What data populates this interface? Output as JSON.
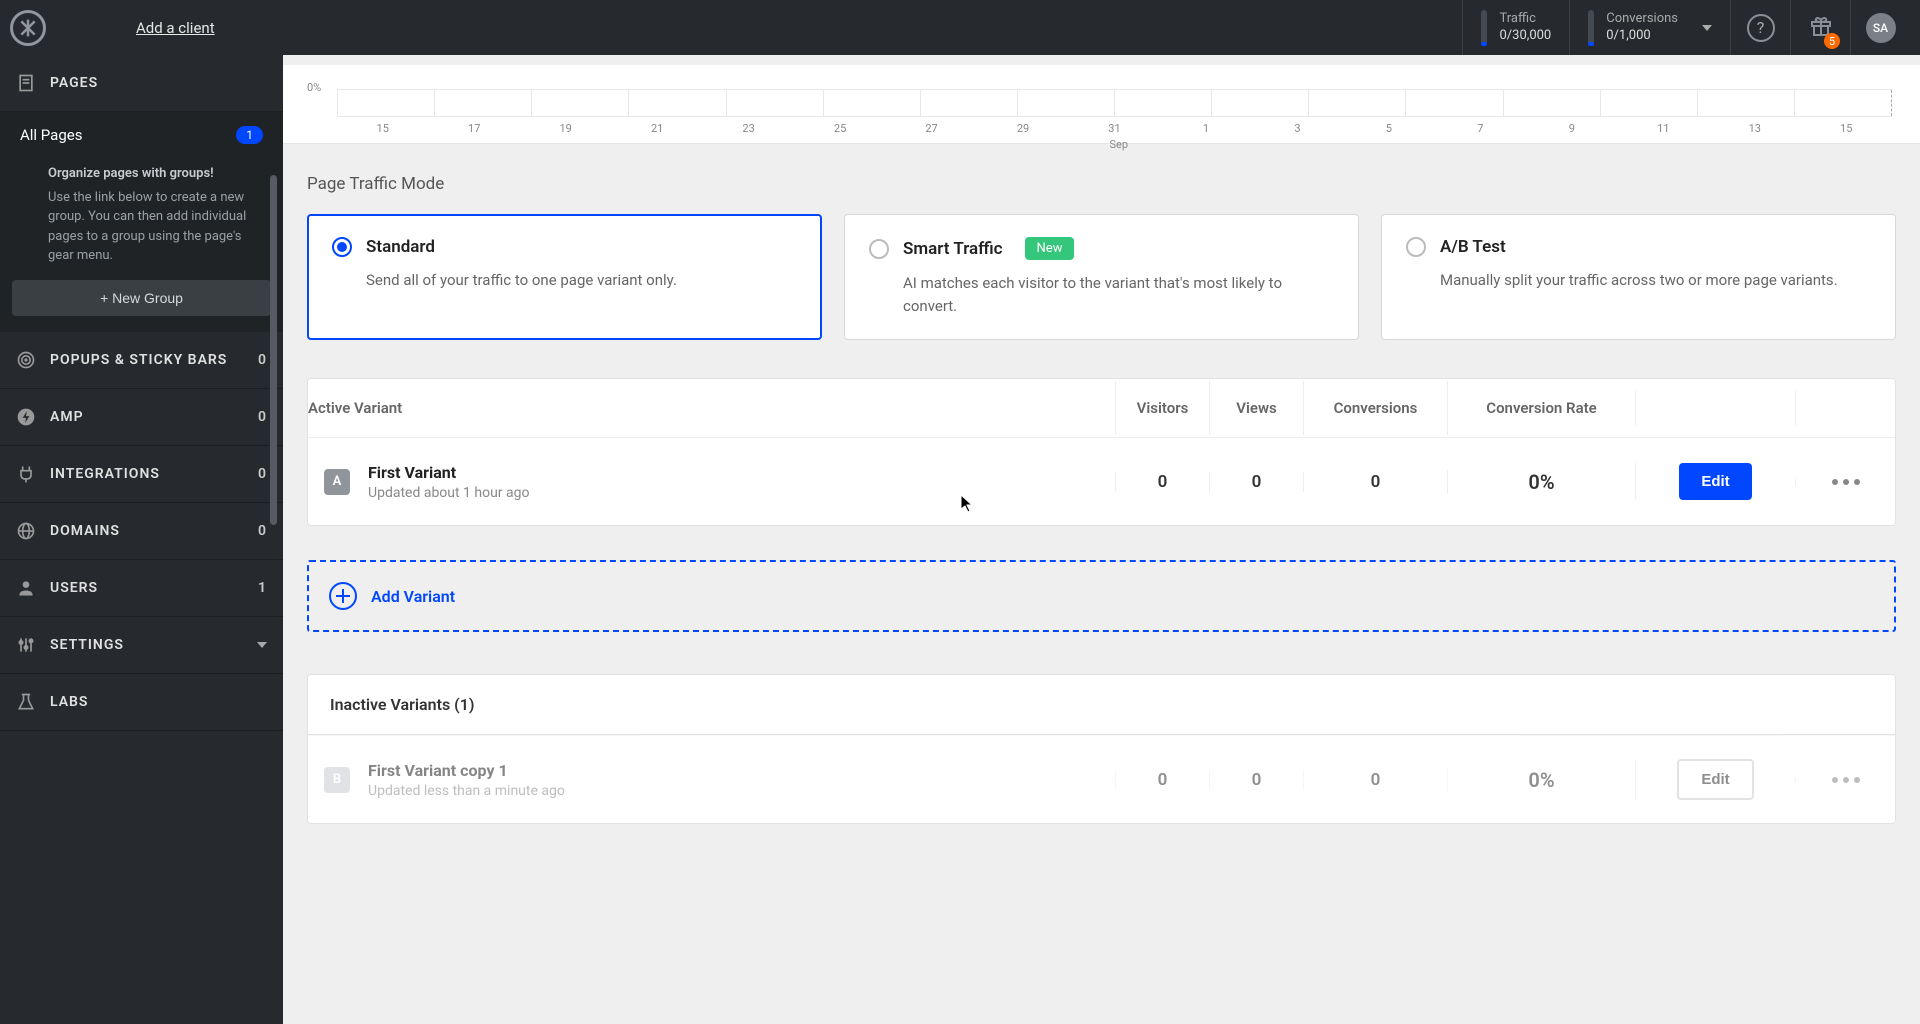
{
  "topbar": {
    "add_client": "Add a client",
    "traffic_label": "Traffic",
    "traffic_value": "0/30,000",
    "conversions_label": "Conversions",
    "conversions_value": "0/1,000",
    "gift_badge": "5",
    "avatar": "SA"
  },
  "sidebar": {
    "pages_label": "PAGES",
    "all_pages": "All Pages",
    "all_pages_count": "1",
    "groups_title": "Organize pages with groups!",
    "groups_body": "Use the link below to create a new group. You can then add individual pages to a group using the page's gear menu.",
    "new_group": "+ New Group",
    "items": [
      {
        "label": "POPUPS & STICKY BARS",
        "count": "0"
      },
      {
        "label": "AMP",
        "count": "0"
      },
      {
        "label": "INTEGRATIONS",
        "count": "0"
      },
      {
        "label": "DOMAINS",
        "count": "0"
      },
      {
        "label": "USERS",
        "count": "1"
      },
      {
        "label": "SETTINGS",
        "count": ""
      },
      {
        "label": "LABS",
        "count": ""
      }
    ]
  },
  "chart_data": {
    "type": "line",
    "ylabel": "0%",
    "month_label": "Sep",
    "categories": [
      "15",
      "17",
      "19",
      "21",
      "23",
      "25",
      "27",
      "29",
      "31",
      "1",
      "3",
      "5",
      "7",
      "9",
      "11",
      "13",
      "15"
    ],
    "values": []
  },
  "traffic_mode": {
    "title": "Page Traffic Mode",
    "options": [
      {
        "name": "Standard",
        "desc": "Send all of your traffic to one page variant only.",
        "selected": true
      },
      {
        "name": "Smart Traffic",
        "badge": "New",
        "desc": "AI matches each visitor to the variant that's most likely to convert.",
        "selected": false
      },
      {
        "name": "A/B Test",
        "desc": "Manually split your traffic across two or more page variants.",
        "selected": false
      }
    ]
  },
  "table": {
    "headers": {
      "variant": "Active Variant",
      "visitors": "Visitors",
      "views": "Views",
      "conversions": "Conversions",
      "rate": "Conversion Rate"
    },
    "active": [
      {
        "badge": "A",
        "name": "First Variant",
        "updated": "Updated about 1 hour ago",
        "visitors": "0",
        "views": "0",
        "conversions": "0",
        "rate": "0%",
        "edit": "Edit"
      }
    ],
    "add_variant": "Add Variant",
    "inactive_heading": "Inactive Variants (1)",
    "inactive": [
      {
        "badge": "B",
        "name": "First Variant copy 1",
        "updated": "Updated less than a minute ago",
        "visitors": "0",
        "views": "0",
        "conversions": "0",
        "rate": "0%",
        "edit": "Edit"
      }
    ]
  }
}
